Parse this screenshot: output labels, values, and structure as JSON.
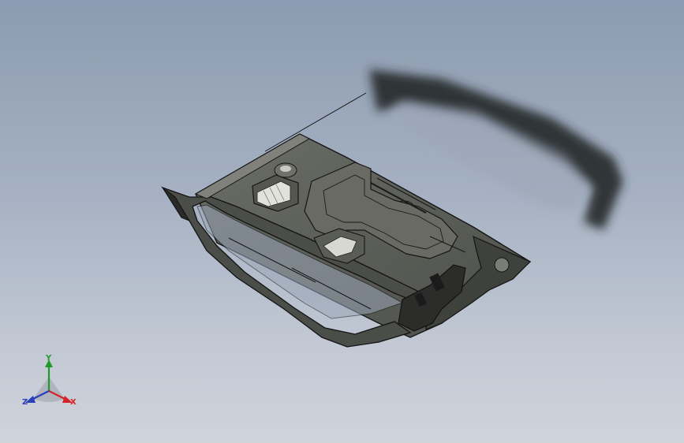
{
  "viewport": {
    "background_top": "#8c9bb1",
    "background_bottom": "#cfd3da"
  },
  "model": {
    "body_color": "#5d5f5a",
    "edge_color": "#161616",
    "highlight_color": "#e8e8e2"
  },
  "triad": {
    "x_label": "X",
    "y_label": "Y",
    "z_label": "Z",
    "x_color": "#d4242a",
    "y_color": "#1f9a2b",
    "z_color": "#2a3fb8"
  }
}
